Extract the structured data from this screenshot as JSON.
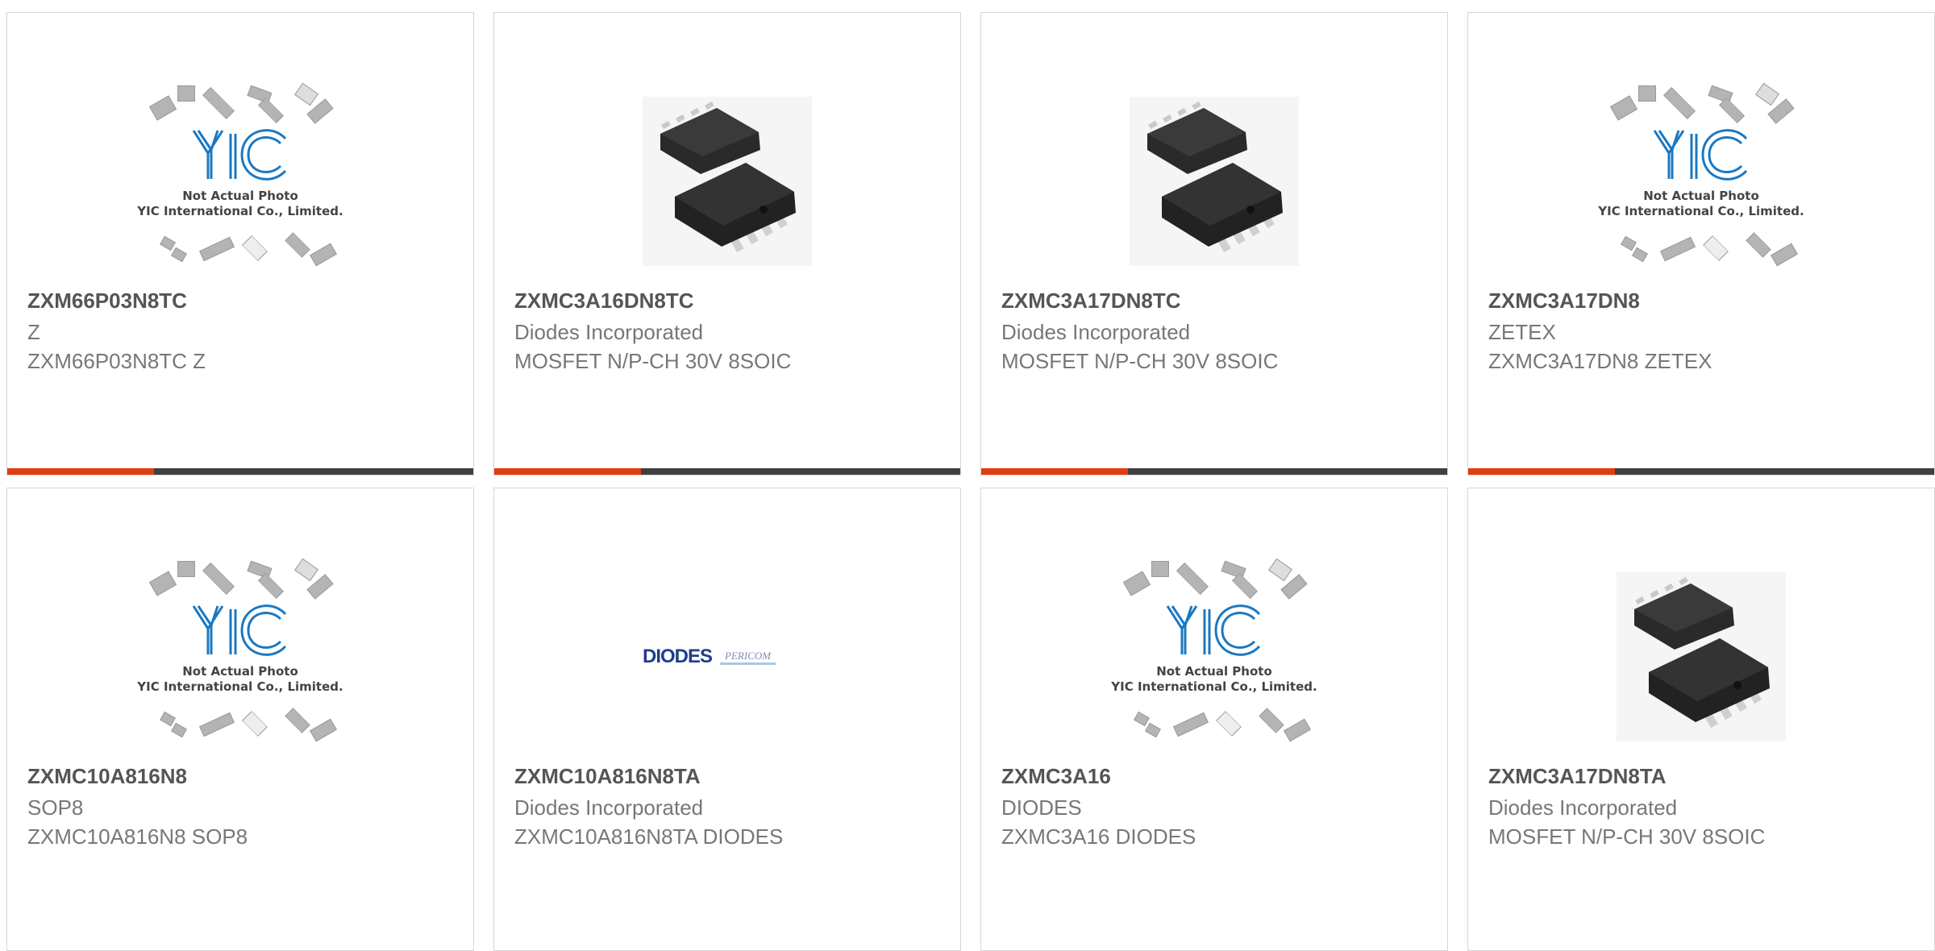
{
  "products": [
    {
      "part": "ZXM66P03N8TC",
      "manufacturer": "Z",
      "description": "ZXM66P03N8TC Z",
      "image": "yic-placeholder"
    },
    {
      "part": "ZXMC3A16DN8TC",
      "manufacturer": "Diodes Incorporated",
      "description": "MOSFET N/P-CH 30V 8SOIC",
      "image": "soic8-photo"
    },
    {
      "part": "ZXMC3A17DN8TC",
      "manufacturer": "Diodes Incorporated",
      "description": "MOSFET N/P-CH 30V 8SOIC",
      "image": "soic8-photo"
    },
    {
      "part": "ZXMC3A17DN8",
      "manufacturer": "ZETEX",
      "description": "ZXMC3A17DN8 ZETEX",
      "image": "yic-placeholder"
    },
    {
      "part": "ZXMC10A816N8",
      "manufacturer": "SOP8",
      "description": "ZXMC10A816N8 SOP8",
      "image": "yic-placeholder"
    },
    {
      "part": "ZXMC10A816N8TA",
      "manufacturer": "Diodes Incorporated",
      "description": "ZXMC10A816N8TA DIODES",
      "image": "diodes-logo"
    },
    {
      "part": "ZXMC3A16",
      "manufacturer": "DIODES",
      "description": "ZXMC3A16 DIODES",
      "image": "yic-placeholder"
    },
    {
      "part": "ZXMC3A17DN8TA",
      "manufacturer": "Diodes Incorporated",
      "description": "MOSFET N/P-CH 30V 8SOIC",
      "image": "soic8-photo"
    }
  ],
  "placeholder": {
    "line1": "Not Actual Photo",
    "line2": "YIC International Co., Limited."
  },
  "diodes_logo": {
    "brand": "DIODES",
    "partner": "PERICOM"
  },
  "colors": {
    "accent": "#e33b12",
    "bar": "#404040",
    "logo_blue": "#1a78c2"
  }
}
